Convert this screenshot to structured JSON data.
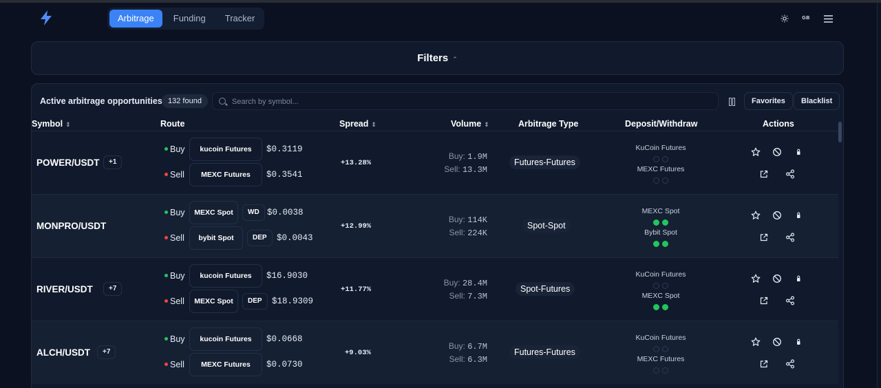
{
  "nav": {
    "tabs": [
      "Arbitrage",
      "Funding",
      "Tracker"
    ],
    "active": "Arbitrage",
    "lang": "GB"
  },
  "filters": {
    "title": "Filters"
  },
  "toolbar": {
    "title": "Active arbitrage opportunities",
    "found": "132 found",
    "search_placeholder": "Search by symbol...",
    "favorites": "Favorites",
    "blacklist": "Blacklist"
  },
  "table": {
    "columns": {
      "symbol": "Symbol",
      "route": "Route",
      "spread": "Spread",
      "volume": "Volume",
      "type": "Arbitrage Type",
      "dw": "Deposit/Withdraw",
      "actions": "Actions"
    },
    "buy_label": "Buy",
    "sell_label": "Sell",
    "vol_buy_label": "Buy:",
    "vol_sell_label": "Sell:",
    "rows": [
      {
        "symbol": "POWER/USDT",
        "extra": "+1",
        "buy": {
          "exchange": "kucoin Futures",
          "tag": "",
          "price": "$0.3119"
        },
        "sell": {
          "exchange": "MEXC Futures",
          "tag": "",
          "price": "$0.3541"
        },
        "spread": "+13.28%",
        "vol_buy": "1.9M",
        "vol_sell": "13.3M",
        "type": "Futures-Futures",
        "dw": [
          {
            "name": "KuCoin Futures",
            "dep": false,
            "wd": false
          },
          {
            "name": "MEXC Futures",
            "dep": false,
            "wd": false
          }
        ]
      },
      {
        "symbol": "MONPRO/USDT",
        "extra": "",
        "buy": {
          "exchange": "MEXC Spot",
          "tag": "WD",
          "price": "$0.0038"
        },
        "sell": {
          "exchange": "bybit Spot",
          "tag": "DEP",
          "price": "$0.0043"
        },
        "spread": "+12.99%",
        "vol_buy": "114K",
        "vol_sell": "224K",
        "type": "Spot-Spot",
        "dw": [
          {
            "name": "MEXC Spot",
            "dep": true,
            "wd": true
          },
          {
            "name": "Bybit Spot",
            "dep": true,
            "wd": true
          }
        ]
      },
      {
        "symbol": "RIVER/USDT",
        "extra": "+7",
        "buy": {
          "exchange": "kucoin Futures",
          "tag": "",
          "price": "$16.9030"
        },
        "sell": {
          "exchange": "MEXC Spot",
          "tag": "DEP",
          "price": "$18.9309"
        },
        "spread": "+11.77%",
        "vol_buy": "28.4M",
        "vol_sell": "7.3M",
        "type": "Spot-Futures",
        "dw": [
          {
            "name": "KuCoin Futures",
            "dep": false,
            "wd": false
          },
          {
            "name": "MEXC Spot",
            "dep": true,
            "wd": true
          }
        ]
      },
      {
        "symbol": "ALCH/USDT",
        "extra": "+7",
        "buy": {
          "exchange": "kucoin Futures",
          "tag": "",
          "price": "$0.0668"
        },
        "sell": {
          "exchange": "MEXC Futures",
          "tag": "",
          "price": "$0.0730"
        },
        "spread": "+9.03%",
        "vol_buy": "6.7M",
        "vol_sell": "6.3M",
        "type": "Futures-Futures",
        "dw": [
          {
            "name": "KuCoin Futures",
            "dep": false,
            "wd": false
          },
          {
            "name": "MEXC Futures",
            "dep": false,
            "wd": false
          }
        ]
      }
    ]
  },
  "colors": {
    "accent": "#3b82f6",
    "buy_dot": "#22c55e",
    "sell_dot": "#ef4444",
    "status_on": "#22c55e"
  }
}
